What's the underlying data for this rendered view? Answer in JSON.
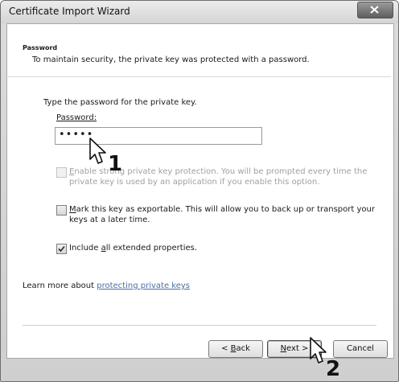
{
  "window": {
    "title": "Certificate Import Wizard"
  },
  "header": {
    "title": "Password",
    "description": "To maintain security, the private key was protected with a password."
  },
  "form": {
    "prompt": "Type the password for the private key.",
    "password_label": "Password:",
    "password_value": "•••••"
  },
  "options": [
    {
      "line1_hotkey": "E",
      "line1_rest": "nable strong private key protection. You will be prompted every time the",
      "line2": "private key is used by an application if you enable this option.",
      "checked": false,
      "enabled": false
    },
    {
      "line1_hotkey": "M",
      "line1_rest": "ark this key as exportable. This will allow you to back up or transport your",
      "line2": "keys at a later time.",
      "checked": false,
      "enabled": true
    },
    {
      "line1_pre": "Include ",
      "line1_hotkey": "a",
      "line1_rest": "ll extended properties.",
      "checked": true,
      "enabled": true
    }
  ],
  "learn_more": {
    "prefix": "Learn more about ",
    "link": "protecting private keys"
  },
  "buttons": {
    "back": {
      "pre": "< ",
      "hotkey": "B",
      "rest": "ack"
    },
    "next": {
      "hotkey": "N",
      "rest": "ext >"
    },
    "cancel": "Cancel"
  },
  "annotations": {
    "step1": "1",
    "step2": "2"
  }
}
